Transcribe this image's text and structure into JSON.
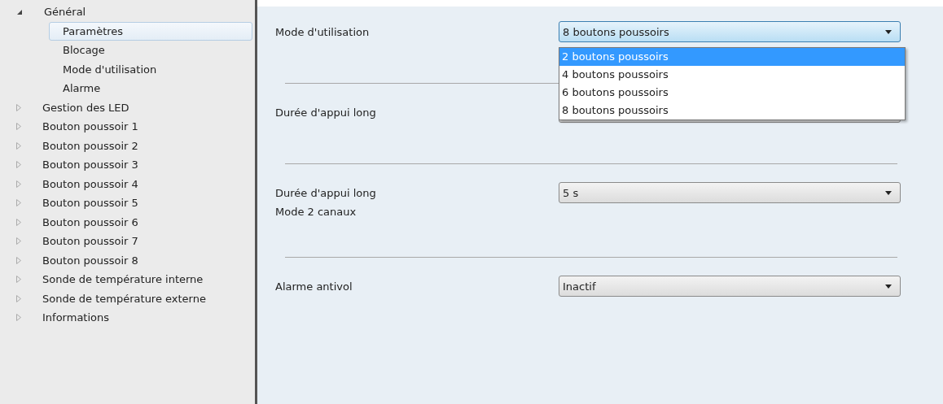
{
  "tree": [
    {
      "label": "Général",
      "expanded": true,
      "selected": false,
      "children": [
        {
          "label": "Paramètres",
          "selected": true
        },
        {
          "label": "Blocage",
          "selected": false
        },
        {
          "label": "Mode d'utilisation",
          "selected": false
        },
        {
          "label": "Alarme",
          "selected": false
        }
      ]
    },
    {
      "label": "Gestion des LED",
      "expanded": false,
      "selected": false
    },
    {
      "label": "Bouton poussoir 1",
      "expanded": false,
      "selected": false
    },
    {
      "label": "Bouton poussoir 2",
      "expanded": false,
      "selected": false
    },
    {
      "label": "Bouton poussoir 3",
      "expanded": false,
      "selected": false
    },
    {
      "label": "Bouton poussoir 4",
      "expanded": false,
      "selected": false
    },
    {
      "label": "Bouton poussoir 5",
      "expanded": false,
      "selected": false
    },
    {
      "label": "Bouton poussoir 6",
      "expanded": false,
      "selected": false
    },
    {
      "label": "Bouton poussoir 7",
      "expanded": false,
      "selected": false
    },
    {
      "label": "Bouton poussoir 8",
      "expanded": false,
      "selected": false
    },
    {
      "label": "Sonde de température interne",
      "expanded": false,
      "selected": false
    },
    {
      "label": "Sonde de température externe",
      "expanded": false,
      "selected": false
    },
    {
      "label": "Informations",
      "expanded": false,
      "selected": false
    }
  ],
  "settings": [
    {
      "label": [
        "Mode d'utilisation"
      ],
      "value": "8 boutons poussoirs",
      "open": true,
      "options": [
        {
          "label": "2 boutons poussoirs",
          "highlighted": true
        },
        {
          "label": "4 boutons poussoirs",
          "highlighted": false
        },
        {
          "label": "6 boutons poussoirs",
          "highlighted": false
        },
        {
          "label": "8 boutons poussoirs",
          "highlighted": false
        }
      ]
    },
    {
      "label": [
        "Durée d'appui long"
      ],
      "open": false
    },
    {
      "label": [
        "Durée d'appui long",
        "Mode 2 canaux"
      ],
      "value": "5 s",
      "open": false
    },
    {
      "label": [
        "Alarme antivol"
      ],
      "value": "Inactif",
      "open": false
    }
  ]
}
